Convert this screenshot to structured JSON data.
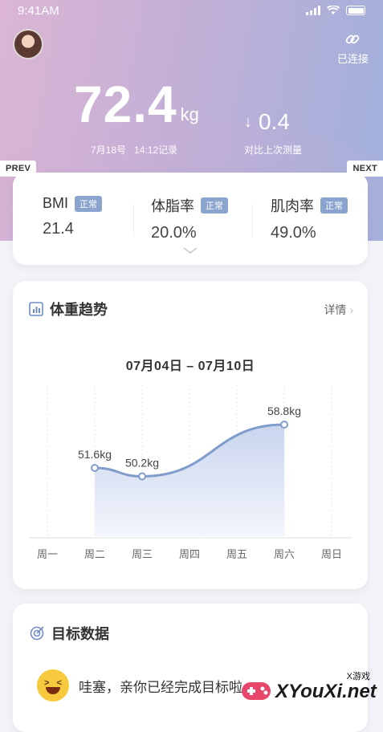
{
  "status_bar": {
    "time": "9:41AM"
  },
  "header": {
    "connect_label": "已连接",
    "weight": "72.4",
    "unit": "kg",
    "record_date": "7月18号",
    "record_time": "14:12记录",
    "diff_arrow": "↓",
    "diff_value": "0.4",
    "diff_label": "对比上次测量",
    "prev_label": "PREV",
    "next_label": "NEXT"
  },
  "metrics": [
    {
      "name": "BMI",
      "badge": "正常",
      "value": "21.4"
    },
    {
      "name": "体脂率",
      "badge": "正常",
      "value": "20.0%"
    },
    {
      "name": "肌肉率",
      "badge": "正常",
      "value": "49.0%"
    }
  ],
  "trend": {
    "title": "体重趋势",
    "detail": "详情",
    "range": "07月04日 – 07月10日"
  },
  "chart_data": {
    "type": "area",
    "categories": [
      "周一",
      "周二",
      "周三",
      "周四",
      "周五",
      "周六",
      "周日"
    ],
    "series": [
      {
        "values": [
          null,
          51.6,
          50.2,
          null,
          null,
          58.8,
          null
        ],
        "labels": [
          "",
          "51.6kg",
          "50.2kg",
          "",
          "",
          "58.8kg",
          ""
        ]
      }
    ],
    "ylim": [
      40,
      62
    ],
    "grid": "vertical-dashed",
    "colors": {
      "line": "#7f9ccb",
      "fill_top": "#c9d5ee",
      "fill_bottom": "#f4f6fc"
    }
  },
  "goal": {
    "title": "目标数据",
    "message": "哇塞，亲你已经完成目标啦"
  },
  "watermark": {
    "small": "X游戏",
    "big": "XYouXi.net"
  }
}
